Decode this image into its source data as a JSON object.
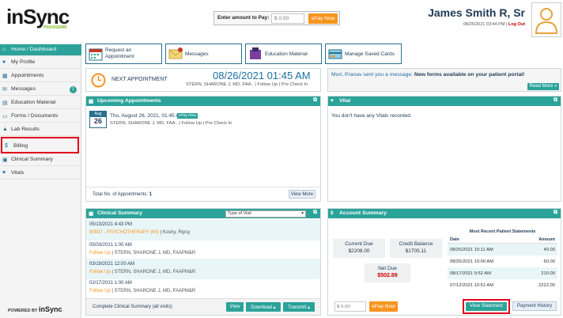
{
  "header": {
    "logo": "inSync",
    "logo_sub": "PRAXISEMR",
    "pay_label": "Enter amount to Pay:",
    "pay_placeholder": "$ 0.00",
    "epay_label": "ePay Now",
    "user_name": "James Smith R, Sr",
    "datetime": "08/25/2021 03:44 PM |",
    "logout": "Log Out"
  },
  "sidebar": {
    "items": [
      {
        "label": "Home / Dashboard",
        "icon": "home-icon"
      },
      {
        "label": "My Profile",
        "icon": "user-icon"
      },
      {
        "label": "Appointments",
        "icon": "calendar-icon"
      },
      {
        "label": "Messages",
        "icon": "envelope-icon",
        "badge": "1"
      },
      {
        "label": "Education Material",
        "icon": "book-icon"
      },
      {
        "label": "Forms / Documents",
        "icon": "document-icon"
      },
      {
        "label": "Lab Results",
        "icon": "flask-icon"
      },
      {
        "label": "Billing",
        "icon": "dollar-icon"
      },
      {
        "label": "Clinical Summary",
        "icon": "clipboard-icon"
      },
      {
        "label": "Vitals",
        "icon": "heart-icon"
      }
    ],
    "powered_by": "POWERED BY",
    "powered_brand": "inSync"
  },
  "quick_links": [
    {
      "label": "Request an Appointment",
      "icon": "calendar-icon"
    },
    {
      "label": "Messages",
      "icon": "envelope-icon",
      "badge": "1"
    },
    {
      "label": "Education Material",
      "icon": "book-icon"
    },
    {
      "label": "Manage Saved Cards",
      "icon": "credit-card-icon"
    }
  ],
  "next_appointment": {
    "label": "NEXT APPOINTMENT",
    "datetime": "08/26/2021 01:45 AM",
    "detail": "STERN, SHARONE J, MD, FAA.. | Follow Up | Pre Check In"
  },
  "message_banner": {
    "from": "Mori, Pranav sent you a message:",
    "subject": "New forms available on your patient portal!",
    "read_more": "Read More"
  },
  "upcoming": {
    "title": "Upcoming Appointments",
    "month": "Aug",
    "day": "26",
    "when": "Thu, August 26, 2021, 01:45 AM",
    "epay": "ePay Now",
    "detail": "STERN, SHARONE J, MD, FAA.. | Follow Up | Pre Check In",
    "total_label": "Total No. of Appointments:",
    "total": "1",
    "view_more": "View More"
  },
  "vital": {
    "title": "Vital",
    "empty": "You don't have any Vitals recorded."
  },
  "clinical": {
    "title": "Clinical Summary",
    "filter": "Type of Visit",
    "entries": [
      {
        "date": "05/13/2021 4:43 PM",
        "line": "90837 - PSYCHOTHERAPY (60)",
        "who": " | Koshy, Ripsy"
      },
      {
        "date": "05/03/2021 1:00 AM",
        "line": "Follow Up",
        "who": " | STERN, SHARONE J, MD, FAAPM&R"
      },
      {
        "date": "03/19/2021 12:00 AM",
        "line": "Follow Up",
        "who": " | STERN, SHARONE J, MD, FAAPM&R"
      },
      {
        "date": "02/17/2021 1:00 AM",
        "line": "Follow Up",
        "who": " | STERN, SHARONE J, MD, FAAPM&R"
      }
    ],
    "complete_link": "Complete Clinical Summary (all visits)",
    "view": "View",
    "download": "Download",
    "transmit": "Transmit"
  },
  "account": {
    "title": "Account Summary",
    "current_due_label": "Current Due",
    "current_due": "$2208.00",
    "credit_label": "Credit Balance",
    "credit": "$1705.11",
    "net_due_label": "Net Due",
    "net_due": "$502.89",
    "statements_title": "Most Recent Patient Statements",
    "col_date": "Date",
    "col_amount": "Amount",
    "statements": [
      {
        "date": "08/25/2021 10:11 AM",
        "amount": "40.00"
      },
      {
        "date": "08/25/2021 10:00 AM",
        "amount": "60.00"
      },
      {
        "date": "08/17/2021 9:52 AM",
        "amount": "210.00"
      },
      {
        "date": "07/12/2021 10:51 AM",
        "amount": "2222.00"
      }
    ],
    "pay_placeholder": "$ 0.00",
    "epay": "ePay Now",
    "view_statement": "View Statement",
    "payment_history": "Payment History"
  }
}
